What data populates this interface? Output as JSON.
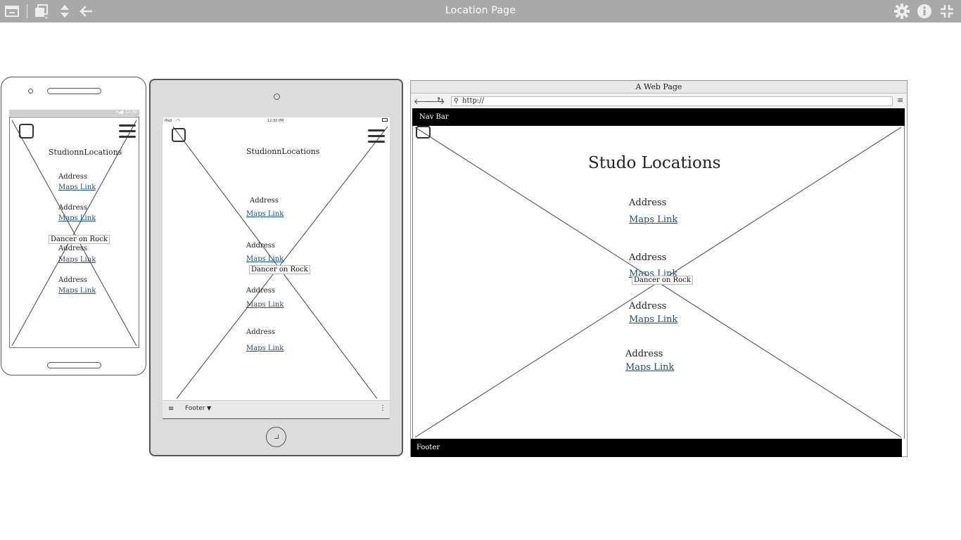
{
  "window": {
    "title": "Location Page",
    "icons": [
      "window-icon",
      "layers-icon",
      "sort-icon",
      "back-arrow-icon",
      "gear-icon",
      "info-icon",
      "collapse-icon"
    ]
  },
  "phone": {
    "page_title": "StudionnLocations",
    "locations": [
      {
        "address": "Address",
        "link": "Maps Link"
      },
      {
        "address": "Address",
        "link": "Maps Link"
      },
      {
        "address": "Address",
        "link": "Maps Link"
      },
      {
        "address": "Address",
        "link": "Maps Link"
      }
    ],
    "image_label": "Dancer on Rock"
  },
  "tablet": {
    "status_left": "iPad",
    "status_center": "12:30 PM",
    "page_title": "StudionnLocations",
    "locations": [
      {
        "address": "Address",
        "link": "Maps Link"
      },
      {
        "address": "Address",
        "link": "Maps Link"
      },
      {
        "address": "Address",
        "link": "Maps Link"
      },
      {
        "address": "Address",
        "link": "Maps Link"
      }
    ],
    "image_label": "Dancer on Rock",
    "footer_label": "Footer"
  },
  "browser": {
    "window_title": "A Web Page",
    "url": "http://",
    "navbar_label": "Nav Bar",
    "page_title": "Studo Locations",
    "locations": [
      {
        "address": "Address",
        "link": "Maps Link"
      },
      {
        "address": "Address",
        "link": "Maps Link"
      },
      {
        "address": "Address",
        "link": "Maps Link"
      },
      {
        "address": "Address",
        "link": "Maps Link"
      }
    ],
    "image_label": "Dancer on Rock",
    "footer_label": "Footer"
  },
  "colors": {
    "toolbar": "#a9a9a9",
    "link": "#1a4f7a",
    "bar": "#000000"
  }
}
